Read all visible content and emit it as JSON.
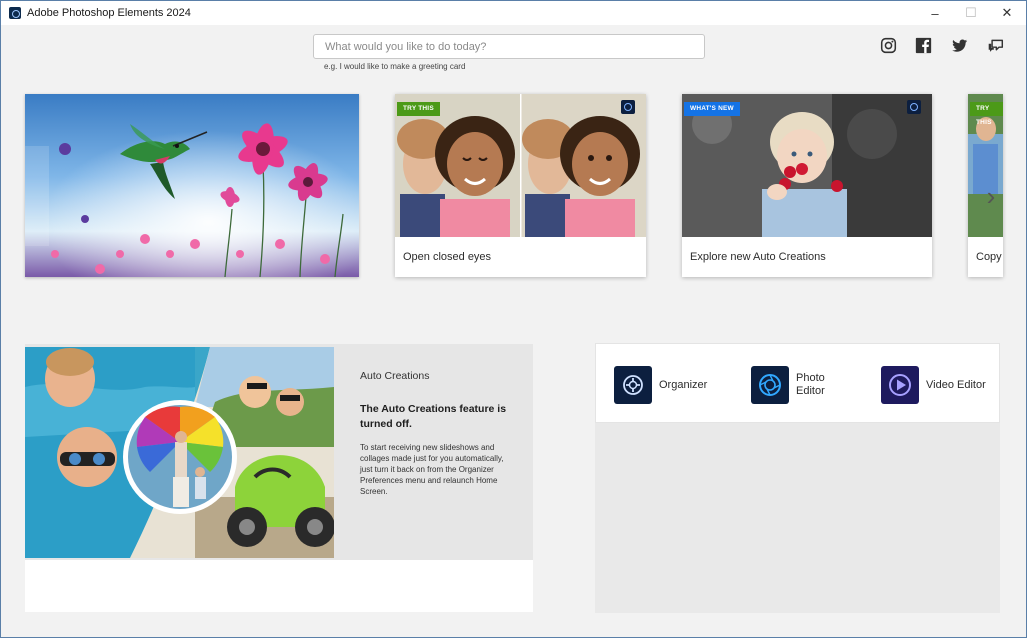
{
  "window": {
    "title": "Adobe Photoshop Elements 2024"
  },
  "search": {
    "placeholder": "What would you like to do today?",
    "hint": "e.g. I would like to make a greeting card"
  },
  "social": [
    "instagram-icon",
    "facebook-icon",
    "twitter-icon",
    "feedback-icon"
  ],
  "carousel": {
    "cards": [
      {
        "badge": "TRY THIS",
        "label": "Open closed eyes"
      },
      {
        "badge": "WHAT'S NEW",
        "label": "Explore new Auto Creations"
      },
      {
        "badge": "TRY THIS",
        "label": "Copy"
      }
    ]
  },
  "auto_creations": {
    "heading": "Auto Creations",
    "title": "The Auto Creations feature is turned off.",
    "body": "To start receiving new slideshows and collages made just for you automatically, just turn it back on from the Organizer Preferences menu and relaunch Home Screen."
  },
  "apps": [
    {
      "name": "Organizer"
    },
    {
      "name": "Photo Editor"
    },
    {
      "name": "Video Editor"
    }
  ],
  "colors": {
    "try_badge": "#4c9a18",
    "new_badge": "#1473e6",
    "app_tile": "#0c1f3f"
  }
}
